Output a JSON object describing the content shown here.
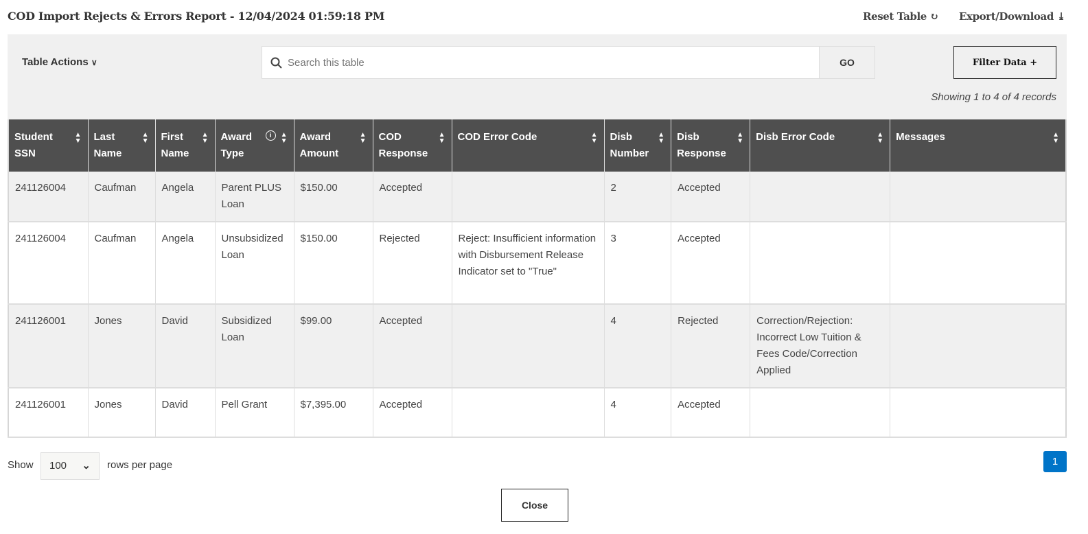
{
  "header": {
    "title": "COD Import Rejects & Errors Report - 12/04/2024 01:59:18 PM",
    "reset_label": "Reset Table",
    "reset_icon": "↻",
    "export_label": "Export/Download",
    "export_icon": "⤓"
  },
  "toolbar": {
    "table_actions": "Table Actions",
    "chevron": "⌄",
    "search_placeholder": "Search this table",
    "search_value": "",
    "go_label": "GO",
    "filter_label": "Filter Data +",
    "showing": "Showing 1 to 4 of 4 records"
  },
  "table": {
    "columns": [
      "Student SSN",
      "Last Name",
      "First Name",
      "Award Type",
      "Award Amount",
      "COD Response",
      "COD Error Code",
      "Disb Number",
      "Disb Response",
      "Disb Error Code",
      "Messages"
    ],
    "rows": [
      [
        "241126004",
        "Caufman",
        "Angela",
        "Parent PLUS Loan",
        "$150.00",
        "Accepted",
        "",
        "2",
        "Accepted",
        "",
        ""
      ],
      [
        "241126004",
        "Caufman",
        "Angela",
        "Unsubsidized Loan",
        "$150.00",
        "Rejected",
        "Reject: Insufficient information with Disbursement Release Indicator set to \"True\"",
        "3",
        "Accepted",
        "",
        ""
      ],
      [
        "241126001",
        "Jones",
        "David",
        "Subsidized Loan",
        "$99.00",
        "Accepted",
        "",
        "4",
        "Rejected",
        "Correction/Rejection: Incorrect Low Tuition & Fees Code/Correction Applied",
        ""
      ],
      [
        "241126001",
        "Jones",
        "David",
        "Pell Grant",
        "$7,395.00",
        "Accepted",
        "",
        "4",
        "Accepted",
        "",
        ""
      ]
    ]
  },
  "footer": {
    "show": "Show",
    "rows_per_page_value": "100",
    "rows_per_page": "rows per page",
    "current_page": "1",
    "close_label": "Close"
  },
  "colors": {
    "header_bg": "#4f4f4f",
    "accent": "#0074c8",
    "toolbar_bg": "#f0f0f0"
  }
}
